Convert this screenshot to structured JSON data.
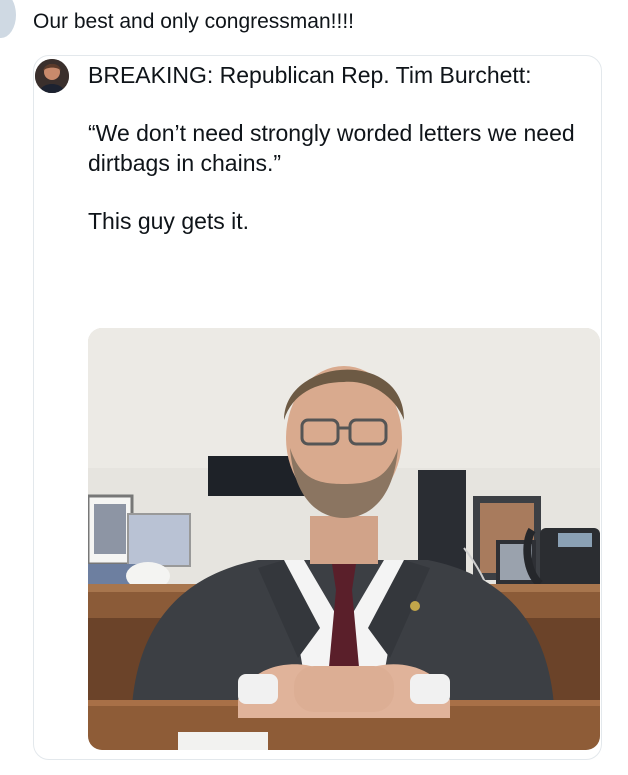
{
  "post": {
    "text": "Our best and only congressman!!!!"
  },
  "quote": {
    "line1": "BREAKING: Republican Rep. Tim Burchett:",
    "line2": "“We don’t need strongly worded letters we need dirtbags in chains.”",
    "line3": "This guy gets it."
  },
  "icons": {
    "photo": "photo-of-congressman-at-desk"
  }
}
